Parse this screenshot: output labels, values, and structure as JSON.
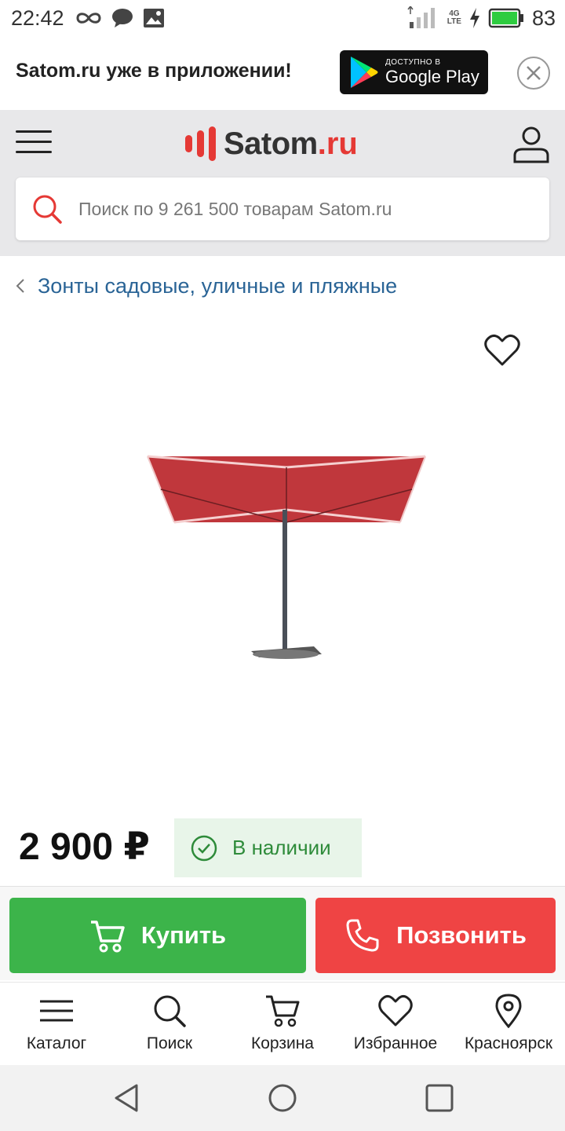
{
  "status_bar": {
    "time": "22:42",
    "battery": "83",
    "network": "4G",
    "network_sub": "LTE",
    "icons": [
      "infinity-icon",
      "chat-icon",
      "image-icon",
      "signal-icon",
      "charging-icon",
      "battery-icon"
    ]
  },
  "app_banner": {
    "text": "Satom.ru уже в приложении!",
    "store_small": "ДОСТУПНО В",
    "store_big": "Google Play"
  },
  "header": {
    "logo_name": "Satom",
    "logo_tld": ".ru",
    "search_placeholder": "Поиск по 9 261 500 товарам Satom.ru"
  },
  "breadcrumb": {
    "label": "Зонты садовые, уличные и пляжные"
  },
  "product": {
    "price": "2 900 ₽",
    "stock": "В наличии"
  },
  "actions": {
    "buy": "Купить",
    "call": "Позвонить"
  },
  "bottom_nav": {
    "items": [
      {
        "label": "Каталог",
        "icon": "menu-icon"
      },
      {
        "label": "Поиск",
        "icon": "search-icon"
      },
      {
        "label": "Корзина",
        "icon": "cart-icon"
      },
      {
        "label": "Избранное",
        "icon": "heart-icon"
      },
      {
        "label": "Красноярск",
        "icon": "location-pin-icon"
      }
    ]
  },
  "colors": {
    "brand_red": "#e53935",
    "buy_green": "#3cb44a",
    "call_red": "#ef4444",
    "link_blue": "#2a6496",
    "stock_green": "#2e8b3a"
  }
}
